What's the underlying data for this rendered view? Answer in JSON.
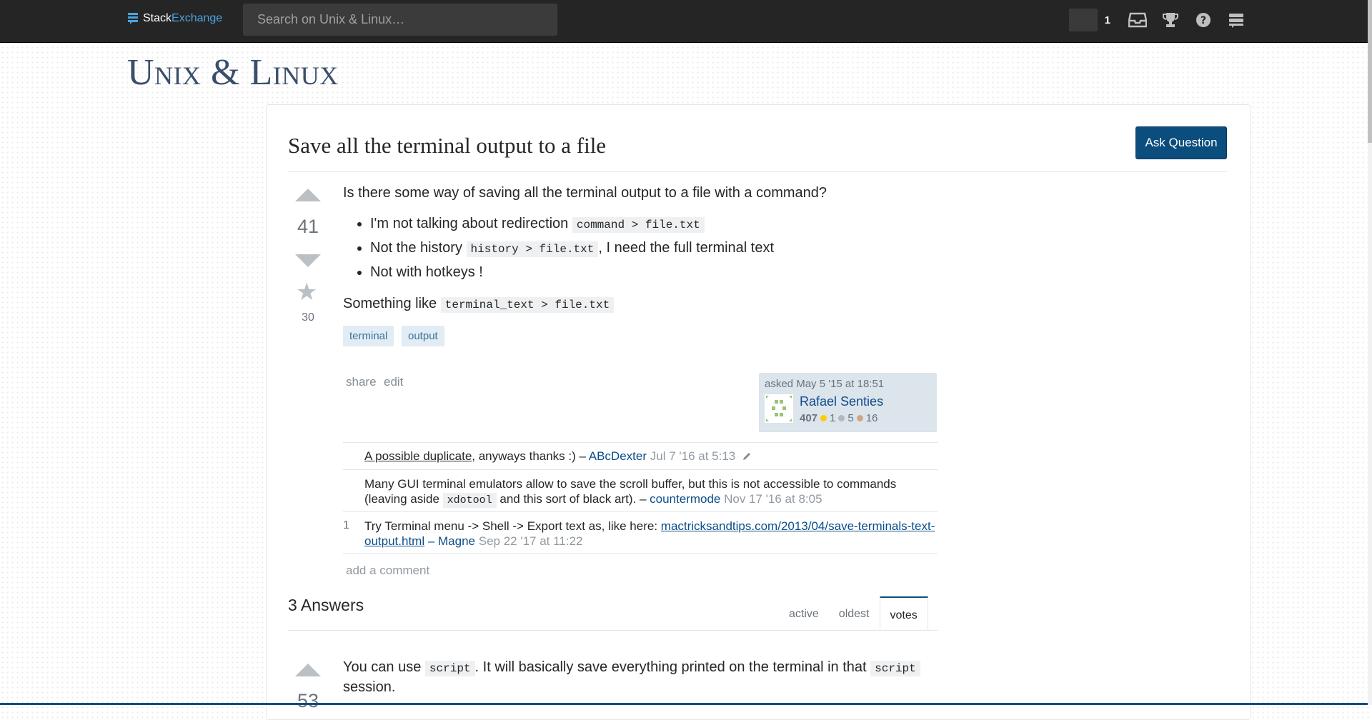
{
  "topbar": {
    "logo_left": "Stack",
    "logo_right": "Exchange",
    "search_placeholder": "Search on Unix & Linux…",
    "reputation": "1",
    "icons": [
      "inbox-icon",
      "trophy-icon",
      "help-icon",
      "site-switcher-icon"
    ]
  },
  "site": {
    "title": "Unix & Linux"
  },
  "question": {
    "title": "Save all the terminal output to a file",
    "ask_button": "Ask Question",
    "score": "41",
    "favorites": "30",
    "intro": "Is there some way of saving all the terminal output to a file with a command?",
    "bullets": [
      {
        "text": "I'm not talking about redirection ",
        "code": "command > file.txt",
        "after": ""
      },
      {
        "text": "Not the history ",
        "code": "history > file.txt",
        "after": ", I need the full terminal text"
      },
      {
        "text": "Not with hotkeys !",
        "code": "",
        "after": ""
      }
    ],
    "something_like": "Something like ",
    "something_code": "terminal_text > file.txt",
    "tags": [
      "terminal",
      "output"
    ],
    "menu": {
      "share": "share",
      "edit": "edit"
    },
    "owner": {
      "asked": "asked May 5 '15 at 18:51",
      "name": "Rafael Senties",
      "reputation": "407",
      "gold": "1",
      "silver": "5",
      "bronze": "16"
    }
  },
  "comments": [
    {
      "score": "",
      "link_text": "A possible duplicate",
      "text": ", anyways thanks :) – ",
      "user": "ABcDexter",
      "date": "Jul 7 '16 at 5:13"
    },
    {
      "score": "",
      "text_a": "Many GUI terminal emulators allow to save the scroll buffer, but this is not accessible to commands (leaving aside ",
      "code": "xdotool",
      "text_b": " and this sort of black art). – ",
      "user": "countermode",
      "date": "Nov 17 '16 at 8:05"
    },
    {
      "score": "1",
      "text": "Try Terminal menu -> Shell -> Export text as, like here: ",
      "link": "mactricksandtips.com/2013/04/save-terminals-text-output.html",
      "sep": " – ",
      "user": "Magne",
      "date": "Sep 22 '17 at 11:22"
    }
  ],
  "add_comment": "add a comment",
  "answers": {
    "heading": "3 Answers",
    "tabs": [
      "active",
      "oldest",
      "votes"
    ],
    "active_tab": "votes",
    "first": {
      "score": "53",
      "text_a": "You can use ",
      "code_a": "script",
      "text_b": ". It will basically save everything printed on the terminal in that ",
      "code_b": "script",
      "text_c": "session."
    }
  },
  "colors": {
    "topbar": "#252525",
    "accent": "#0b4d7c",
    "tag_bg": "#e1ecf4",
    "tag_fg": "#39739d",
    "link": "#0c4d8a"
  }
}
